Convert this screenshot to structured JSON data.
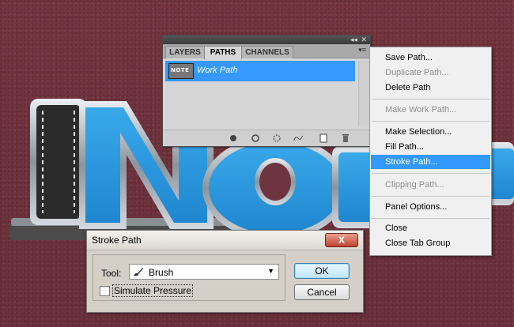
{
  "panel": {
    "tabs": [
      {
        "label": "LAYERS",
        "active": false
      },
      {
        "label": "PATHS",
        "active": true
      },
      {
        "label": "CHANNELS",
        "active": false
      }
    ],
    "paths": [
      {
        "thumbnail_text": "NOTE",
        "name": "Work Path",
        "selected": true
      }
    ],
    "footer_icons": [
      "fill-path-icon",
      "stroke-path-icon",
      "load-selection-icon",
      "make-work-path-icon",
      "new-path-icon",
      "delete-path-icon"
    ]
  },
  "context_menu": {
    "items": [
      {
        "label": "Save Path...",
        "enabled": true
      },
      {
        "label": "Duplicate Path...",
        "enabled": false
      },
      {
        "label": "Delete Path",
        "enabled": true
      },
      {
        "label": "Make Work Path...",
        "enabled": false
      },
      {
        "label": "Make Selection...",
        "enabled": true
      },
      {
        "label": "Fill Path...",
        "enabled": true
      },
      {
        "label": "Stroke Path...",
        "enabled": true,
        "highlighted": true
      },
      {
        "label": "Clipping Path...",
        "enabled": false
      },
      {
        "label": "Panel Options...",
        "enabled": true
      },
      {
        "label": "Close",
        "enabled": true
      },
      {
        "label": "Close Tab Group",
        "enabled": true
      }
    ]
  },
  "dialog": {
    "title": "Stroke Path",
    "close_label": "X",
    "tool_label": "Tool:",
    "tool_value": "Brush",
    "simulate_pressure_label": "Simulate Pressure",
    "simulate_pressure_checked": false,
    "ok_label": "OK",
    "cancel_label": "Cancel"
  },
  "artwork": {
    "text": "NOTE",
    "colors": {
      "background": "#6e3440",
      "leather_blue": "#2f9be0",
      "leather_black": "#2b2b2b",
      "stitch": "#e9e9e9",
      "metal": "#b9c0c6"
    }
  }
}
